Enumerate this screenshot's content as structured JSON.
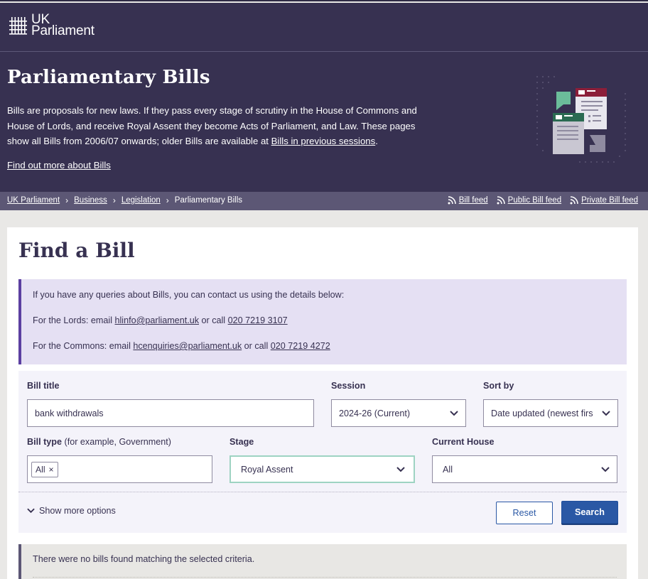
{
  "header": {
    "logo_line1": "UK",
    "logo_line2": "Parliament",
    "title": "Parliamentary Bills",
    "intro_text": "Bills are proposals for new laws. If they pass every stage of scrutiny in the House of Commons and House of Lords, and receive Royal Assent they become Acts of Parliament, and Law. These pages show all Bills from 2006/07 onwards; older Bills are available at ",
    "intro_link": "Bills in previous sessions",
    "intro_end": ".",
    "find_more_link": "Find out more about Bills"
  },
  "breadcrumb": {
    "items": [
      "UK Parliament",
      "Business",
      "Legislation",
      "Parliamentary Bills"
    ]
  },
  "feeds": {
    "items": [
      "Bill feed",
      "Public Bill feed",
      "Private Bill feed"
    ]
  },
  "main": {
    "heading": "Find a Bill"
  },
  "notice": {
    "line1": "If you have any queries about Bills, you can contact us using the details below:",
    "lords_prefix": "For the Lords: email ",
    "lords_email": "hlinfo@parliament.uk",
    "lords_middle": " or call ",
    "lords_phone": "020 7219 3107",
    "commons_prefix": "For the Commons: email ",
    "commons_email": "hcenquiries@parliament.uk",
    "commons_middle": " or call ",
    "commons_phone": "020 7219 4272"
  },
  "filters": {
    "bill_title_label": "Bill title",
    "bill_title_value": "bank withdrawals",
    "session_label": "Session",
    "session_value": "2024-26 (Current)",
    "sort_label": "Sort by",
    "sort_value": "Date updated (newest firs",
    "bill_type_label": "Bill type",
    "bill_type_hint": " (for example, Government)",
    "bill_type_tag": "All",
    "bill_type_remove": "×",
    "stage_label": "Stage",
    "stage_value": "Royal Assent",
    "house_label": "Current House",
    "house_value": "All",
    "show_more": "Show more options",
    "reset": "Reset",
    "search": "Search"
  },
  "results": {
    "message": "There were no bills found matching the selected criteria."
  },
  "colors": {
    "header_bg": "#373151",
    "breadcrumb_bg": "#5c5775",
    "accent_purple": "#5b3fa1",
    "primary_blue": "#2a58a5",
    "focus_green": "#9ed3c2"
  }
}
